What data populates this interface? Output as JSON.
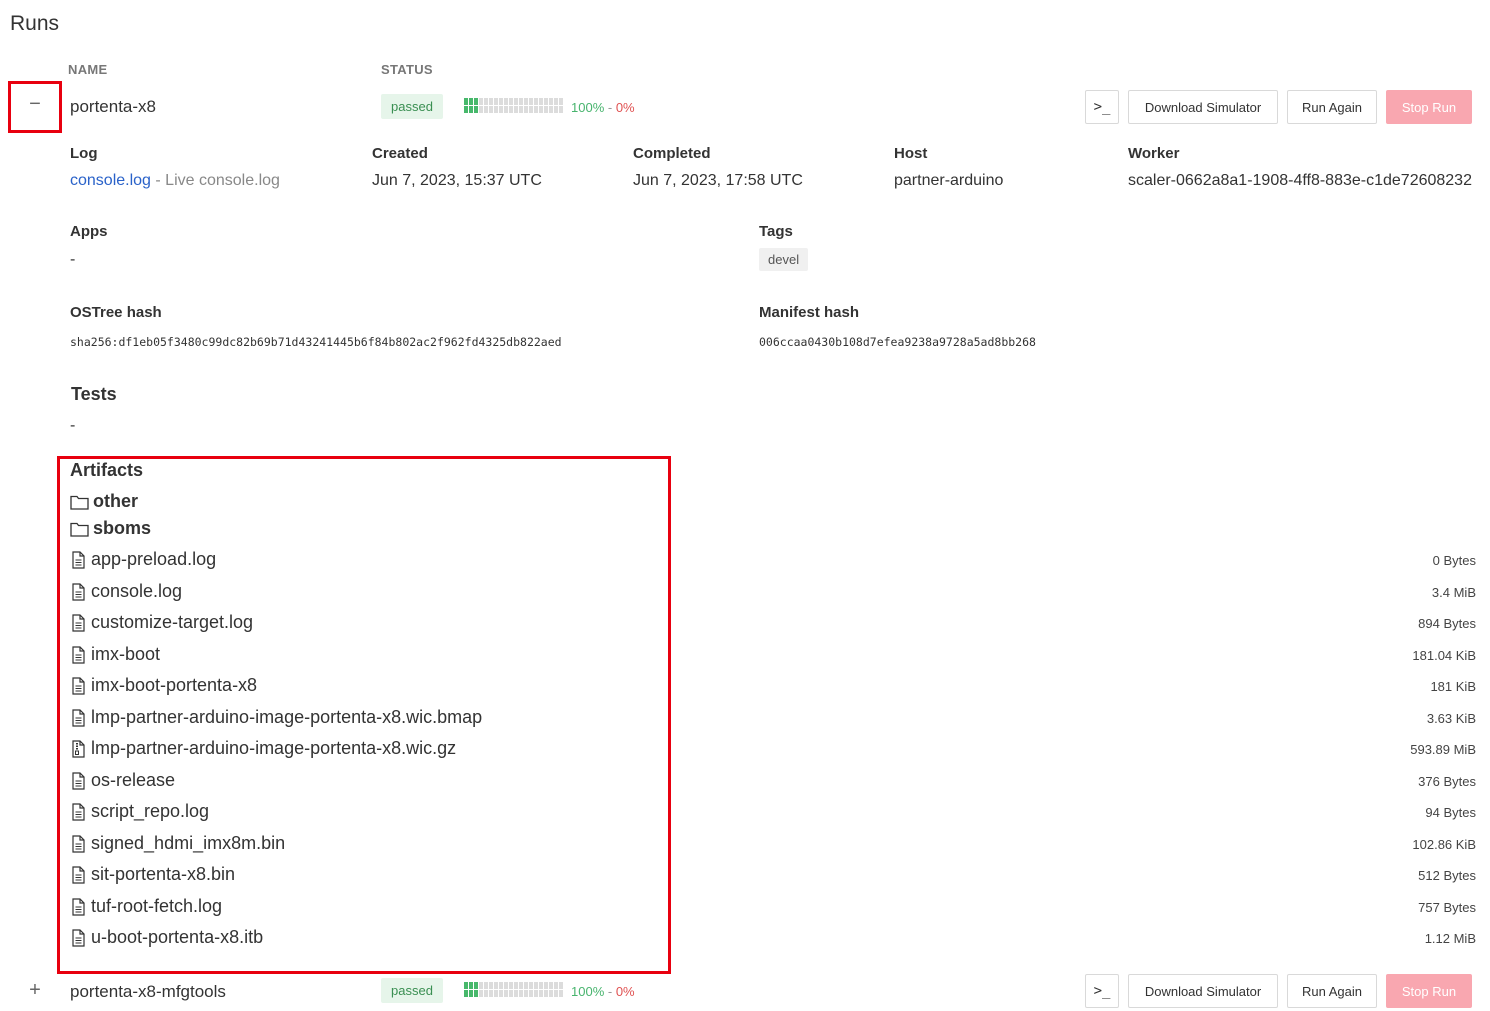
{
  "page": {
    "title": "Runs"
  },
  "columns": {
    "name": "NAME",
    "status": "STATUS"
  },
  "runs": [
    {
      "toggle": "−",
      "name": "portenta-x8",
      "status": "passed",
      "pass_pct": "100%",
      "sep": " - ",
      "fail_pct": "0%",
      "progress_fraction": 0.3,
      "actions": {
        "console_icon": "terminal-icon",
        "download_simulator": "Download Simulator",
        "run_again": "Run Again",
        "stop_run": "Stop Run"
      },
      "details": {
        "log_label": "Log",
        "log_link": "console.log",
        "log_sep": " - ",
        "log_live": "Live console.log",
        "created_label": "Created",
        "created": "Jun 7, 2023, 15:37 UTC",
        "completed_label": "Completed",
        "completed": "Jun 7, 2023, 17:58 UTC",
        "host_label": "Host",
        "host": "partner-arduino",
        "worker_label": "Worker",
        "worker": "scaler-0662a8a1-1908-4ff8-883e-c1de72608232",
        "apps_label": "Apps",
        "apps": "-",
        "tags_label": "Tags",
        "tags": [
          "devel"
        ],
        "ostree_label": "OSTree hash",
        "ostree": "sha256:df1eb05f3480c99dc82b69b71d43241445b6f84b802ac2f962fd4325db822aed",
        "manifest_label": "Manifest hash",
        "manifest": "006ccaa0430b108d7efea9238a9728a5ad8bb268",
        "tests_label": "Tests",
        "tests": "-",
        "artifacts_label": "Artifacts",
        "folders": [
          "other",
          "sboms"
        ],
        "files": [
          {
            "name": "app-preload.log",
            "size": "0 Bytes",
            "icon": "file-text-icon"
          },
          {
            "name": "console.log",
            "size": "3.4 MiB",
            "icon": "file-text-icon"
          },
          {
            "name": "customize-target.log",
            "size": "894 Bytes",
            "icon": "file-text-icon"
          },
          {
            "name": "imx-boot",
            "size": "181.04 KiB",
            "icon": "file-text-icon"
          },
          {
            "name": "imx-boot-portenta-x8",
            "size": "181 KiB",
            "icon": "file-text-icon"
          },
          {
            "name": "lmp-partner-arduino-image-portenta-x8.wic.bmap",
            "size": "3.63 KiB",
            "icon": "file-text-icon"
          },
          {
            "name": "lmp-partner-arduino-image-portenta-x8.wic.gz",
            "size": "593.89 MiB",
            "icon": "file-zip-icon"
          },
          {
            "name": "os-release",
            "size": "376 Bytes",
            "icon": "file-text-icon"
          },
          {
            "name": "script_repo.log",
            "size": "94 Bytes",
            "icon": "file-text-icon"
          },
          {
            "name": "signed_hdmi_imx8m.bin",
            "size": "102.86 KiB",
            "icon": "file-text-icon"
          },
          {
            "name": "sit-portenta-x8.bin",
            "size": "512 Bytes",
            "icon": "file-text-icon"
          },
          {
            "name": "tuf-root-fetch.log",
            "size": "757 Bytes",
            "icon": "file-text-icon"
          },
          {
            "name": "u-boot-portenta-x8.itb",
            "size": "1.12 MiB",
            "icon": "file-text-icon"
          }
        ]
      }
    },
    {
      "toggle": "+",
      "name": "portenta-x8-mfgtools",
      "status": "passed",
      "pass_pct": "100%",
      "sep": " - ",
      "fail_pct": "0%",
      "progress_fraction": 0.3,
      "actions": {
        "console_icon": "terminal-icon",
        "download_simulator": "Download Simulator",
        "run_again": "Run Again",
        "stop_run": "Stop Run"
      }
    }
  ],
  "colors": {
    "passed": "#47b86b",
    "failed": "#e05252",
    "link": "#2a62c9",
    "stop": "#f9a7b0",
    "highlight": "#e8000f"
  }
}
